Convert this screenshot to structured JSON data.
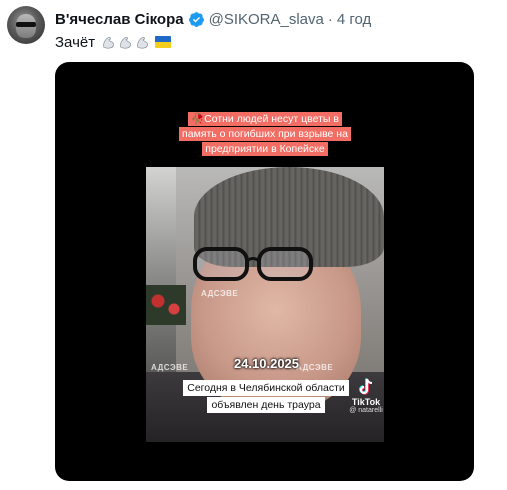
{
  "tweet": {
    "author_name": "В'ячеслав Сікора",
    "handle": "@SIKORA_slava",
    "separator": "·",
    "time": "4 год",
    "text": "Зачёт"
  },
  "icons": {
    "avatar": "avatar-image",
    "verified": "verified-badge-icon",
    "emojis": [
      "flexed-biceps-emoji",
      "flexed-biceps-emoji",
      "flexed-biceps-emoji",
      "ukraine-flag-emoji"
    ]
  },
  "video": {
    "headline_lines": [
      "🥀Сотни людей несут цветы в",
      "память о погибших при взрыве на",
      "предприятии в Копейске"
    ],
    "date": "24.10.2025",
    "caption_lines": [
      "Сегодня в Челябинской области",
      "объявлен день траура"
    ],
    "watermark": "АДСЭВЕ",
    "tiktok_label": "TikTok",
    "tiktok_user": "@ natarelli"
  },
  "colors": {
    "verified_blue": "#1d9bf0",
    "headline_bg": "#f26d63",
    "secondary_text": "#536471",
    "flag_blue": "#1f69c9",
    "flag_yellow": "#f5cd1f"
  }
}
